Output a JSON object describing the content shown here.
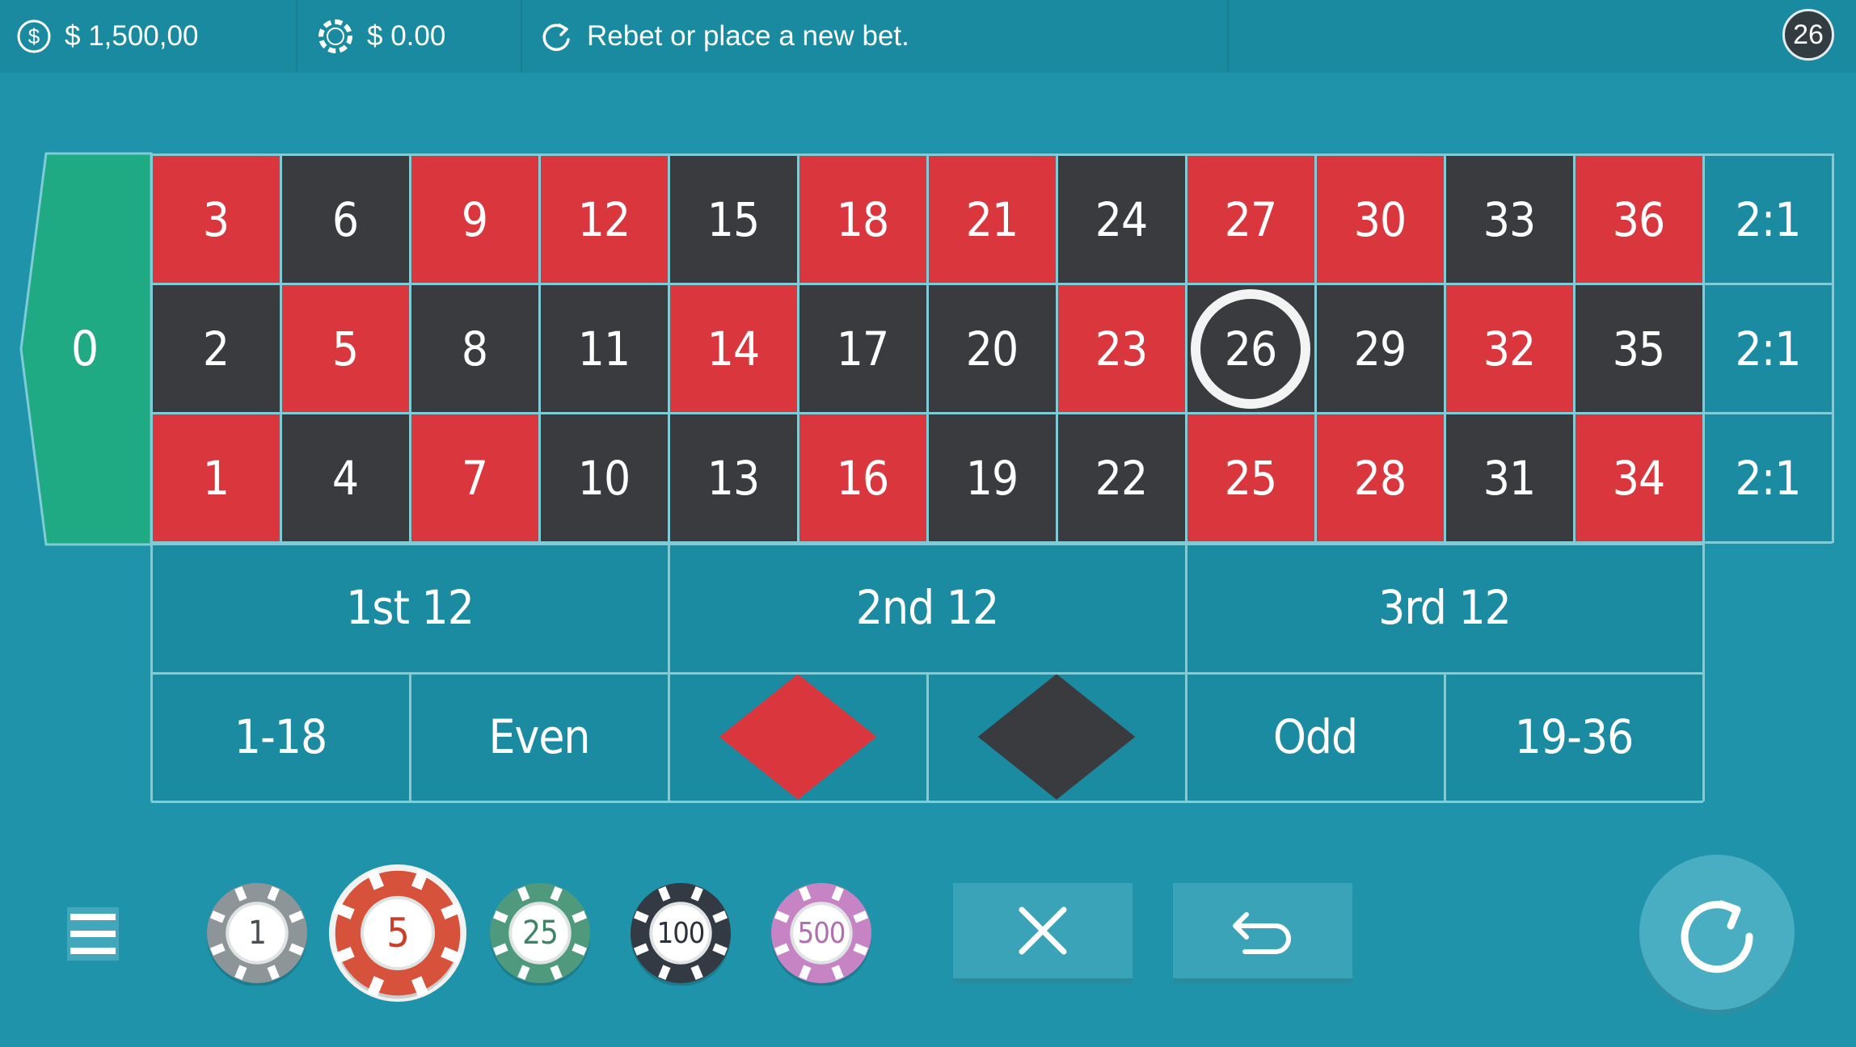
{
  "topbar": {
    "balance": "$ 1,500,00",
    "bet": "$ 0.00",
    "message": "Rebet or place a new bet.",
    "last_number": "26"
  },
  "colors": {
    "felt": "#1e93a9",
    "red": "#d9373d",
    "black": "#3a3b3f",
    "green": "#1faa83"
  },
  "table": {
    "zero": "0",
    "rows": [
      [
        {
          "n": "3",
          "c": "red"
        },
        {
          "n": "6",
          "c": "black"
        },
        {
          "n": "9",
          "c": "red"
        },
        {
          "n": "12",
          "c": "red"
        },
        {
          "n": "15",
          "c": "black"
        },
        {
          "n": "18",
          "c": "red"
        },
        {
          "n": "21",
          "c": "red"
        },
        {
          "n": "24",
          "c": "black"
        },
        {
          "n": "27",
          "c": "red"
        },
        {
          "n": "30",
          "c": "red"
        },
        {
          "n": "33",
          "c": "black"
        },
        {
          "n": "36",
          "c": "red"
        }
      ],
      [
        {
          "n": "2",
          "c": "black"
        },
        {
          "n": "5",
          "c": "red"
        },
        {
          "n": "8",
          "c": "black"
        },
        {
          "n": "11",
          "c": "black"
        },
        {
          "n": "14",
          "c": "red"
        },
        {
          "n": "17",
          "c": "black"
        },
        {
          "n": "20",
          "c": "black"
        },
        {
          "n": "23",
          "c": "red"
        },
        {
          "n": "26",
          "c": "black"
        },
        {
          "n": "29",
          "c": "black"
        },
        {
          "n": "32",
          "c": "red"
        },
        {
          "n": "35",
          "c": "black"
        }
      ],
      [
        {
          "n": "1",
          "c": "red"
        },
        {
          "n": "4",
          "c": "black"
        },
        {
          "n": "7",
          "c": "red"
        },
        {
          "n": "10",
          "c": "black"
        },
        {
          "n": "13",
          "c": "black"
        },
        {
          "n": "16",
          "c": "red"
        },
        {
          "n": "19",
          "c": "black"
        },
        {
          "n": "22",
          "c": "black"
        },
        {
          "n": "25",
          "c": "red"
        },
        {
          "n": "28",
          "c": "red"
        },
        {
          "n": "31",
          "c": "black"
        },
        {
          "n": "34",
          "c": "red"
        }
      ]
    ],
    "columns": [
      "2:1",
      "2:1",
      "2:1"
    ],
    "dozens": [
      "1st 12",
      "2nd 12",
      "3rd 12"
    ],
    "outside": [
      "1-18",
      "Even",
      "",
      "",
      "Odd",
      "19-36"
    ],
    "marked_number": "26"
  },
  "chips": [
    {
      "label": "1",
      "color": "#8e9599",
      "text": "#4a4f52",
      "selected": false
    },
    {
      "label": "5",
      "color": "#d6523a",
      "text": "#c8402b",
      "selected": true
    },
    {
      "label": "25",
      "color": "#4f9a7d",
      "text": "#3d8568",
      "selected": false
    },
    {
      "label": "100",
      "color": "#333a44",
      "text": "#2c323b",
      "selected": false
    },
    {
      "label": "500",
      "color": "#c684c5",
      "text": "#b070b0",
      "selected": false
    }
  ]
}
